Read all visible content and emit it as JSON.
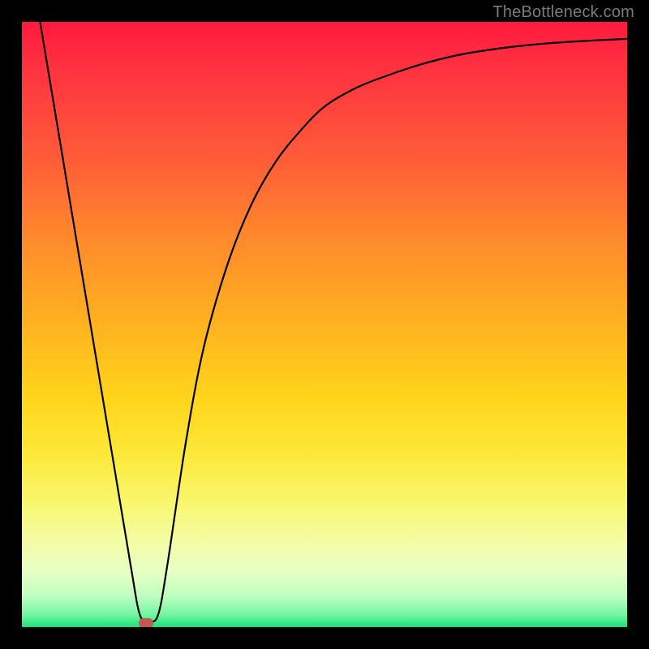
{
  "watermark": "TheBottleneck.com",
  "marker": {
    "x_pct": 20.5,
    "y_pct": 99.3,
    "color": "#c05a50"
  },
  "chart_data": {
    "type": "line",
    "title": "",
    "xlabel": "",
    "ylabel": "",
    "xlim": [
      0,
      100
    ],
    "ylim": [
      0,
      100
    ],
    "grid": false,
    "legend": false,
    "series": [
      {
        "name": "bottleneck-curve",
        "x": [
          3,
          6,
          9,
          12,
          15,
          18,
          19.5,
          21,
          22.5,
          24,
          27,
          30,
          34,
          38,
          42,
          46,
          50,
          55,
          60,
          66,
          72,
          78,
          85,
          92,
          100
        ],
        "y": [
          100,
          82,
          64,
          46,
          28,
          10,
          2,
          1,
          2,
          10,
          30,
          46,
          60,
          70,
          77,
          82,
          86,
          89,
          91,
          93,
          94.5,
          95.5,
          96.3,
          96.8,
          97.2
        ]
      }
    ],
    "background_gradient_stops": [
      {
        "pct": 0,
        "color": "#ff1a3f"
      },
      {
        "pct": 8,
        "color": "#ff3340"
      },
      {
        "pct": 22,
        "color": "#ff5a38"
      },
      {
        "pct": 36,
        "color": "#ff8a2c"
      },
      {
        "pct": 50,
        "color": "#ffb220"
      },
      {
        "pct": 62,
        "color": "#ffd41a"
      },
      {
        "pct": 72,
        "color": "#fce93c"
      },
      {
        "pct": 80,
        "color": "#f8f772"
      },
      {
        "pct": 86,
        "color": "#f4fca6"
      },
      {
        "pct": 91,
        "color": "#e6ffc6"
      },
      {
        "pct": 95,
        "color": "#bcffc0"
      },
      {
        "pct": 98,
        "color": "#72f5a0"
      },
      {
        "pct": 100,
        "color": "#17e27e"
      }
    ]
  }
}
